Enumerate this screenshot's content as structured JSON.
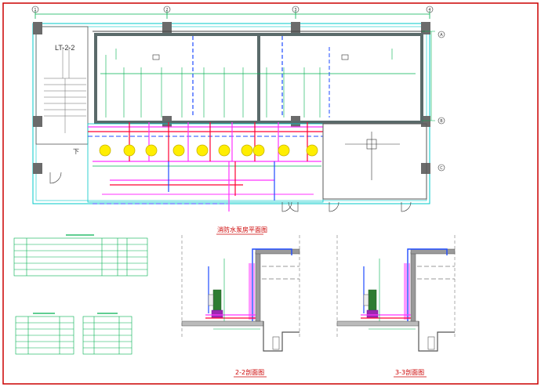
{
  "drawing": {
    "stair_label": "LT-2-2",
    "down_mark": "下",
    "plan_title": "消防水泵房平面图",
    "section_titles": [
      "2-2剖面图",
      "3-3剖面图"
    ],
    "grid_axis_labels": [
      "1",
      "2",
      "3",
      "4",
      "A",
      "B",
      "C"
    ],
    "colors": {
      "frame": "#cc0000",
      "wall": "#5a5a5a",
      "dimension": "#00b050",
      "pipe_red": "#ff0033",
      "pipe_magenta": "#ff33ff",
      "pipe_blue": "#1f4bff",
      "pipe_cyan": "#00c8c8",
      "pump": "#ffee00"
    }
  }
}
